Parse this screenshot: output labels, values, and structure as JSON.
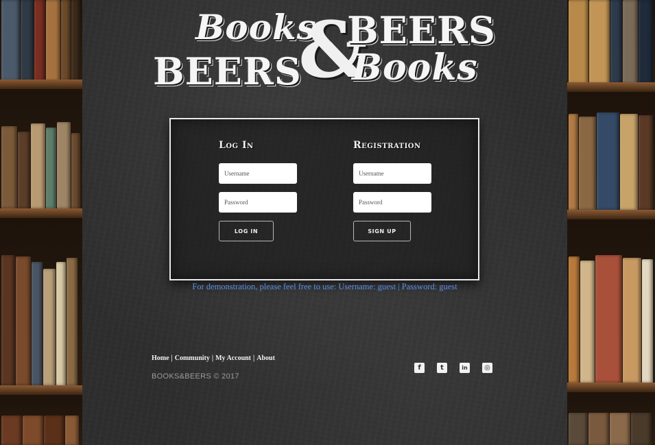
{
  "logo": {
    "line1_left": "Books",
    "line1_right": "BEERS",
    "line2_left": "BEERS",
    "line2_right": "Books",
    "ampersand": "&"
  },
  "login": {
    "title": "Log In",
    "username_placeholder": "Username",
    "password_placeholder": "Password",
    "button": "Log In"
  },
  "registration": {
    "title": "Registration",
    "username_placeholder": "Username",
    "password_placeholder": "Password",
    "button": "Sign Up"
  },
  "demo_note": "For demonstration, please feel free to use: Username: guest | Password: guest",
  "footer": {
    "nav": [
      "Home",
      "Community",
      "My Account",
      "About"
    ],
    "separator": "|",
    "copyright": "BOOKS&BEERS © 2017",
    "social": [
      {
        "icon": "facebook-icon",
        "glyph": "f"
      },
      {
        "icon": "twitter-icon",
        "glyph": "t"
      },
      {
        "icon": "linkedin-icon",
        "glyph": "in"
      },
      {
        "icon": "github-icon",
        "glyph": "◎"
      }
    ]
  },
  "colors": {
    "board": "#2e2e2e",
    "demo_note": "#5c8fe6",
    "copyright": "#9c9c9c",
    "panel_border": "#e9e9e9"
  }
}
